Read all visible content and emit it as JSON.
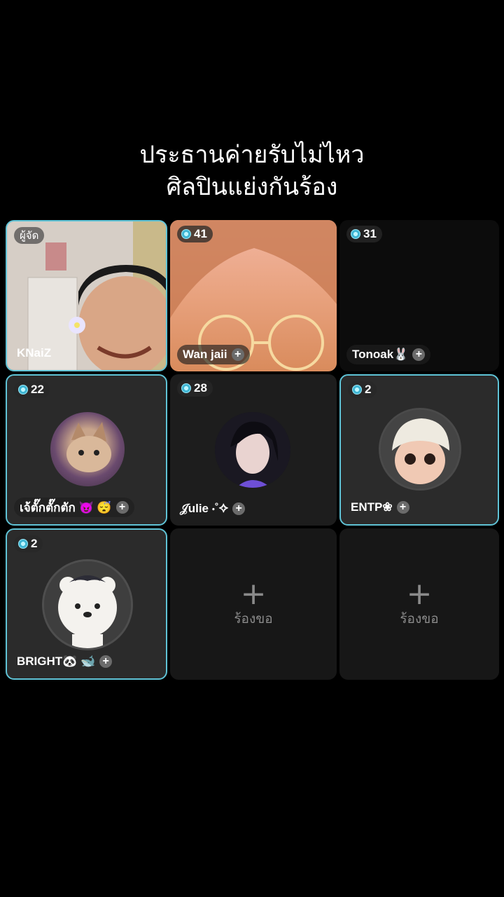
{
  "caption": {
    "line1": "ประธานค่ายรับไม่ไหว",
    "line2": "ศิลปินแย่งกันร้อง"
  },
  "host_badge": "ผู้จัด",
  "seats": [
    {
      "name": "KNaiZ",
      "count": "",
      "role": "host"
    },
    {
      "name": "Wan jaii",
      "count": "41"
    },
    {
      "name": "Tonoak🐰",
      "count": "31"
    },
    {
      "name": "เจ้ตั๊กตั๊กตัก 😈 😴",
      "count": "22"
    },
    {
      "name": "𝒥ulie ⋅˚✧",
      "count": "28"
    },
    {
      "name": "ENTP❀",
      "count": "2"
    },
    {
      "name": "BRIGHT🐼 🐋",
      "count": "2"
    }
  ],
  "empty_seat": {
    "plus": "+",
    "label": "ร้องขอ"
  },
  "accent_color": "#5fc3d6"
}
